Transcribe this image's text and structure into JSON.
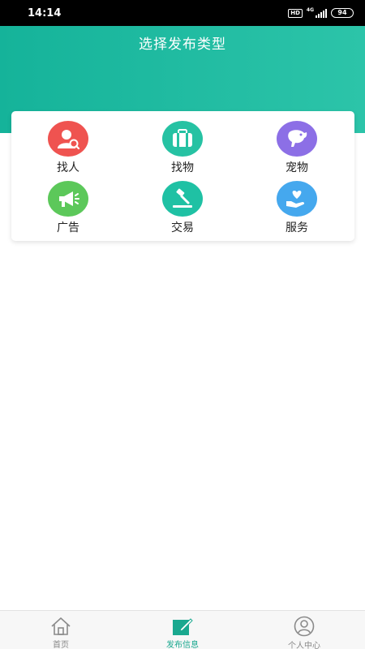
{
  "status_bar": {
    "time": "14:14",
    "hd_badge": "HD",
    "network_type": "4G",
    "battery": "94",
    "signal_icon": "signal-icon"
  },
  "header": {
    "title": "选择发布类型",
    "color_start": "#15b39a",
    "color_end": "#2cc4a9"
  },
  "categories": [
    {
      "label": "找人",
      "icon": "person-search-icon",
      "color": "#ef5350"
    },
    {
      "label": "找物",
      "icon": "suitcase-icon",
      "color": "#26c2a3"
    },
    {
      "label": "宠物",
      "icon": "dog-icon",
      "color": "#8c6fe6"
    },
    {
      "label": "广告",
      "icon": "megaphone-icon",
      "color": "#5cc85a"
    },
    {
      "label": "交易",
      "icon": "gavel-icon",
      "color": "#1fc1a4"
    },
    {
      "label": "服务",
      "icon": "heart-hand-icon",
      "color": "#45a8ee"
    }
  ],
  "tabbar": {
    "items": [
      {
        "label": "首页",
        "icon": "home-icon",
        "active": false
      },
      {
        "label": "发布信息",
        "icon": "edit-icon",
        "active": true
      },
      {
        "label": "个人中心",
        "icon": "user-icon",
        "active": false
      }
    ],
    "active_color": "#1aa88f",
    "inactive_color": "#888888"
  }
}
